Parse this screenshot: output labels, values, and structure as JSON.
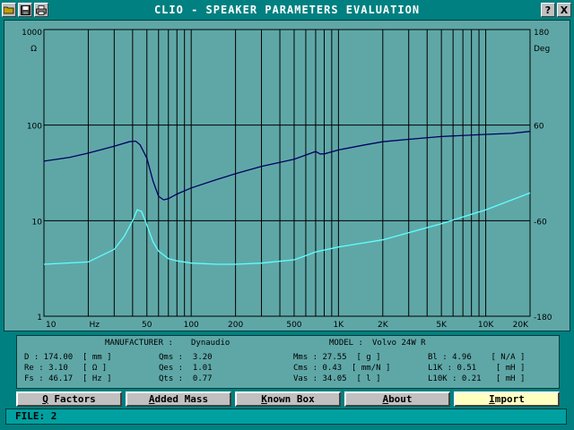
{
  "window": {
    "title": "CLIO - SPEAKER PARAMETERS EVALUATION",
    "help_label": "?",
    "close_label": "X"
  },
  "chart_data": {
    "type": "line",
    "x_scale": "log",
    "xlim": [
      10,
      20000
    ],
    "x_tick_labels": [
      "10",
      "Hz",
      "50",
      "100",
      "200",
      "500",
      "1K",
      "2K",
      "5K",
      "10K",
      "20K"
    ],
    "y_left_scale": "log",
    "y_left_lim": [
      1,
      1000
    ],
    "y_left_unit": "Ω",
    "y_left_tick_labels": [
      "1000",
      "100",
      "10",
      "1"
    ],
    "y_right_lim": [
      -180,
      180
    ],
    "y_right_unit": "Deg",
    "y_right_tick_labels": [
      "180",
      "60",
      "-60",
      "-180"
    ],
    "grid": true,
    "series": [
      {
        "color": "#000060",
        "x": [
          10,
          15,
          20,
          30,
          38,
          42,
          45,
          50,
          55,
          60,
          65,
          70,
          80,
          100,
          150,
          200,
          300,
          500,
          700,
          750,
          800,
          1000,
          1500,
          2000,
          3000,
          5000,
          10000,
          15000,
          20000
        ],
        "y": [
          42,
          46,
          51,
          60,
          67,
          68,
          62,
          45,
          26,
          18,
          16.5,
          17,
          19,
          22,
          27,
          31,
          37,
          44,
          53,
          50,
          50,
          55,
          62,
          67,
          71,
          76,
          80,
          82,
          86
        ]
      },
      {
        "color": "#60ffff",
        "x": [
          10,
          20,
          30,
          35,
          40,
          43,
          46,
          50,
          55,
          60,
          70,
          80,
          100,
          150,
          200,
          300,
          500,
          600,
          700,
          1000,
          2000,
          3000,
          5000,
          10000,
          20000
        ],
        "y": [
          3.5,
          3.7,
          5,
          6.8,
          10,
          13,
          12.5,
          9,
          6,
          4.8,
          4,
          3.8,
          3.6,
          3.5,
          3.5,
          3.6,
          3.9,
          4.3,
          4.7,
          5.3,
          6.3,
          7.5,
          9.3,
          13,
          19.5
        ]
      }
    ]
  },
  "params": {
    "manufacturer_label": "MANUFACTURER :",
    "manufacturer_value": "Dynaudio",
    "model_label": "MODEL :",
    "model_value": "Volvo 24W R",
    "rows": [
      [
        "D : 174.00  [ mm ]",
        "Qms :  3.20",
        "Mms : 27.55  [ g ]",
        "Bl : 4.96    [ N/A ]"
      ],
      [
        "Re : 3.10   [ Ω ]",
        "Qes :  1.01",
        "Cms : 0.43  [ mm/N ]",
        "L1K : 0.51    [ mH ]"
      ],
      [
        "Fs : 46.17  [ Hz ]",
        "Qts :  0.77",
        "Vas : 34.05  [ l ]",
        "L10K : 0.21   [ mH ]"
      ]
    ]
  },
  "buttons": [
    {
      "label": "Q Factors",
      "underline": "Q"
    },
    {
      "label": "Added Mass",
      "underline": "A"
    },
    {
      "label": "Known Box",
      "underline": "K"
    },
    {
      "label": "About",
      "underline": "A"
    },
    {
      "label": "Import",
      "underline": "I"
    }
  ],
  "status": {
    "text": "FILE: 2"
  }
}
